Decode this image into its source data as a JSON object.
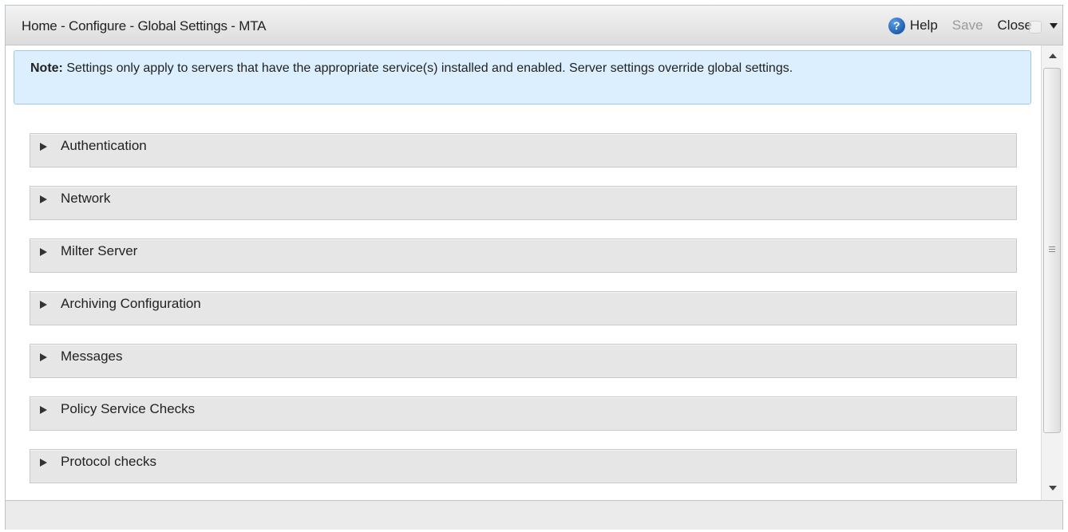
{
  "header": {
    "breadcrumb": "Home - Configure - Global Settings - MTA",
    "help_icon": "?",
    "help_label": "Help",
    "save_label": "Save",
    "close_label": "Close"
  },
  "note": {
    "prefix": "Note:",
    "text": " Settings only apply to servers that have the appropriate service(s) installed and enabled. Server settings override global settings."
  },
  "sections": [
    {
      "label": "Authentication"
    },
    {
      "label": "Network"
    },
    {
      "label": "Milter Server"
    },
    {
      "label": "Archiving Configuration"
    },
    {
      "label": "Messages"
    },
    {
      "label": "Policy Service Checks"
    },
    {
      "label": "Protocol checks"
    },
    {
      "label": ""
    }
  ],
  "icons": {
    "help": "help-icon",
    "settings": "settings-icon",
    "dropdown": "chevron-down-icon",
    "section_toggle": "expand-arrow-icon"
  },
  "colors": {
    "note_background": "#dcefff",
    "note_border": "#9ec8e8",
    "help_icon": "#1f5fae",
    "save_disabled": "#9a9a9a",
    "section_background": "#e6e6e6"
  }
}
